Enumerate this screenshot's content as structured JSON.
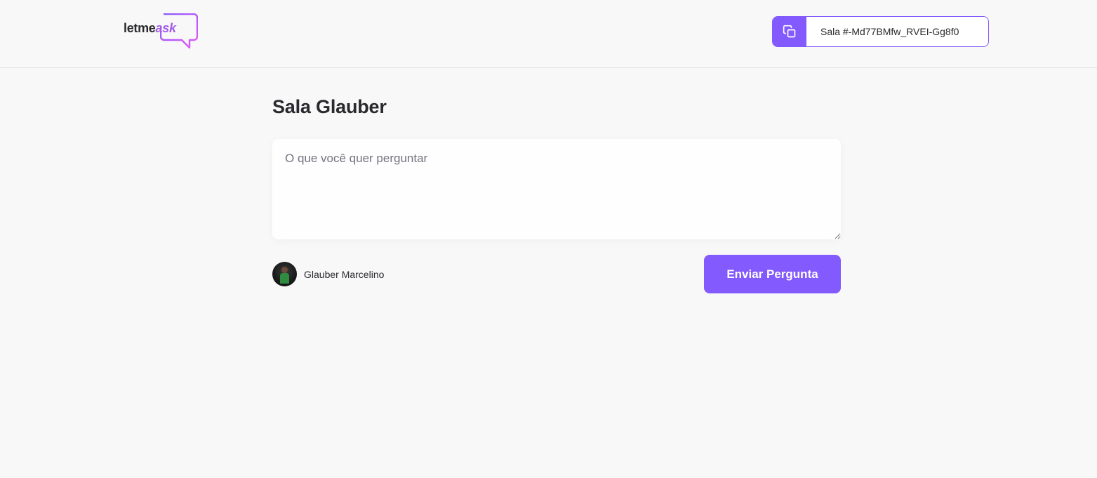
{
  "logo": {
    "text_prefix": "letme",
    "text_accent": "ask"
  },
  "header": {
    "room_code_label": "Sala #-Md77BMfw_RVEI-Gg8f0",
    "copy_icon": "copy-icon"
  },
  "room": {
    "title": "Sala Glauber"
  },
  "question_form": {
    "placeholder": "O que você quer perguntar",
    "value": ""
  },
  "user": {
    "name": "Glauber Marcelino",
    "avatar": "avatar"
  },
  "actions": {
    "submit_label": "Enviar Pergunta"
  },
  "colors": {
    "accent": "#835afd",
    "background": "#f8f8f8",
    "text": "#29292e",
    "placeholder": "#737380",
    "logo_gradient_start": "#835afd",
    "logo_gradient_end": "#e559f9"
  }
}
